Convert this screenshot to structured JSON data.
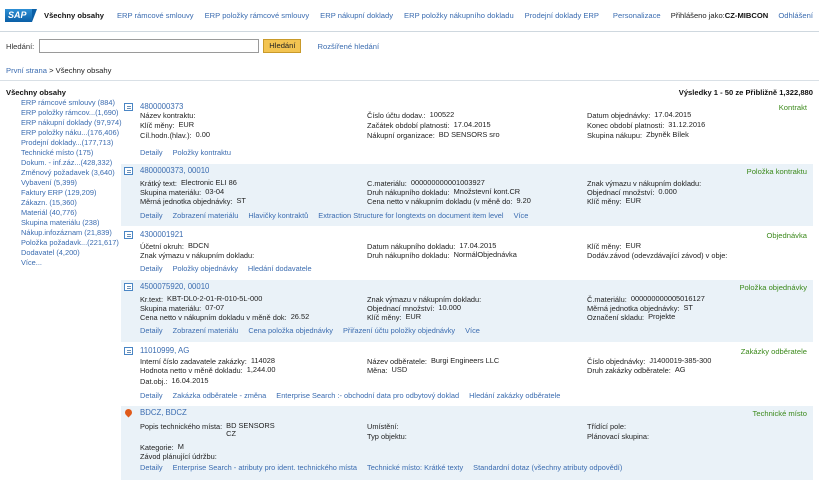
{
  "topbar": {
    "logo": "SAP",
    "nav": [
      "Všechny obsahy",
      "ERP rámcové smlouvy",
      "ERP položky rámcové smlouvy",
      "ERP nákupní doklady",
      "ERP položky nákupního dokladu",
      "Prodejní doklady ERP"
    ],
    "personalize": "Personalizace",
    "logged_label": "Přihlášeno jako:",
    "user": "CZ-MIBCON",
    "logout": "Odhlášení"
  },
  "search": {
    "label": "Hledání:",
    "value": "",
    "button": "Hledání",
    "advanced": "Rozšířené hledání"
  },
  "breadcrumb": {
    "home": "První strana",
    "separator": ">",
    "current": "Všechny obsahy"
  },
  "facets": {
    "title": "Všechny obsahy",
    "items": [
      "ERP rámcové smlouvy (884)",
      "ERP položky rámcov...(1,690)",
      "ERP nákupní doklady (97,974)",
      "ERP položky náku...(176,406)",
      "Prodejní doklady...(177,713)",
      "Technické místo (175)",
      "Dokum. - inf.záz...(428,332)",
      "Změnový požadavek (3,640)",
      "Vybavení (5,399)",
      "Faktury ERP (129,209)",
      "Zákazn. (15,360)",
      "Materiál (40,776)",
      "Skupina materiálu (238)",
      "Nákup.infozáznam (21,839)",
      "Položka požadavk...(221,617)",
      "Dodavatel (4,200)",
      "Více..."
    ]
  },
  "results_text": "Výsledky 1 - 50 ze Přibližně 1,322,880",
  "results": [
    {
      "title": "4800000373",
      "type": "Kontrakt",
      "fields": [
        [
          "Název kontraktu:",
          ""
        ],
        [
          "Číslo účtu dodav.:",
          "100522"
        ],
        [
          "Datum objednávky:",
          "17.04.2015"
        ],
        [
          "Klíč měny:",
          "EUR"
        ],
        [
          "Začátek období platnosti:",
          "17.04.2015"
        ],
        [
          "Konec období platnosti:",
          "31.12.2016"
        ],
        [
          "Cíl.hodn.(hlav.):",
          "0.00"
        ],
        [
          "Nákupní organizace:",
          "BD SENSORS sro"
        ],
        [
          "Skupina nákupu:",
          "Zbyněk Bílek"
        ]
      ],
      "links": [
        "Detaily",
        "Položky kontraktu"
      ]
    },
    {
      "title": "4800000373, 00010",
      "type": "Položka kontraktu",
      "fields": [
        [
          "Krátký text:",
          "Electronic ELI 86"
        ],
        [
          "C.materiálu:",
          "000000000001003927"
        ],
        [
          "Znak výmazu v nákupním dokladu:",
          ""
        ],
        [
          "Skupina materiálu:",
          "03-04"
        ],
        [
          "Druh nákupního dokladu:",
          "Množstevní kont.CR"
        ],
        [
          "Objednací množství:",
          "0.000"
        ],
        [
          "Měrná jednotka objednávky:",
          "ST"
        ],
        [
          "Cena netto v nákupním dokladu (v měně do:",
          "9.20"
        ],
        [
          "Klíč měny:",
          "EUR"
        ]
      ],
      "links": [
        "Detaily",
        "Zobrazení materiálu",
        "Hlavičky kontraktů",
        "Extraction Structure for longtexts on document item level",
        "Více"
      ]
    },
    {
      "title": "4300001921",
      "type": "Objednávka",
      "fields": [
        [
          "Účetní okruh:",
          "BDCN"
        ],
        [
          "Datum nákupního dokladu:",
          "17.04.2015"
        ],
        [
          "Klíč měny:",
          "EUR"
        ],
        [
          "Znak výmazu v nákupním dokladu:",
          ""
        ],
        [
          "Druh nákupního dokladu:",
          "NormálObjednávka"
        ],
        [
          "Dodáv.závod (odevzdávající závod) v obje:",
          ""
        ]
      ],
      "links": [
        "Detaily",
        "Položky objednávky",
        "Hledání dodavatele"
      ]
    },
    {
      "title": "4500075920, 00010",
      "type": "Položka objednávky",
      "fields": [
        [
          "Kr.text:",
          "KBT-DL0-2-01-R-010-5L-000"
        ],
        [
          "Znak výmazu v nákupním dokladu:",
          ""
        ],
        [
          "Č.materiálu:",
          "000000000005016127"
        ],
        [
          "Skupina materiálu:",
          "07-07"
        ],
        [
          "Objednací množství:",
          "10.000"
        ],
        [
          "Měrná jednotka objednávky:",
          "ST"
        ],
        [
          "Cena netto v nákupním dokladu v měně dok:",
          "26.52"
        ],
        [
          "Klíč měny:",
          "EUR"
        ],
        [
          "Označení skladu:",
          "Projekte"
        ]
      ],
      "links": [
        "Detaily",
        "Zobrazení materiálu",
        "Cena položka objednávky",
        "Přiřazení účtu položky objednávky",
        "Více"
      ]
    },
    {
      "title": "11010999, AG",
      "type": "Zakázky odběratele",
      "fields": [
        [
          "Interní číslo zadavatele zakázky:",
          "114028"
        ],
        [
          "Název odběratele:",
          "Burgi Engineers LLC"
        ],
        [
          "Číslo objednávky:",
          "J1400019-385-300"
        ],
        [
          "Hodnota netto v měně dokladu:",
          "1,244.00"
        ],
        [
          "Měna:",
          "USD"
        ],
        [
          "Druh zakázky odběratele:",
          "AG"
        ],
        [
          "Dat.obj.:",
          "16.04.2015"
        ]
      ],
      "links": [
        "Detaily",
        "Zakázka odběratele - změna",
        "Enterprise Search :- obchodní data pro odbytový doklad",
        "Hledání zakázky odběratele"
      ]
    },
    {
      "title": "BDCZ, BDCZ",
      "type": "Technické místo",
      "fields": [
        [
          "Popis technického místa:",
          "BD SENSORS\nCZ"
        ],
        [
          "Umístění:",
          ""
        ],
        [
          "Třídící pole:",
          ""
        ],
        [
          "Kategorie:",
          "M"
        ],
        [
          "Typ objektu:",
          ""
        ],
        [
          "Plánovací skupina:",
          ""
        ],
        [
          "Závod plánující údržbu:",
          ""
        ]
      ],
      "links": [
        "Detaily",
        "Enterprise Search - atributy pro ident. technického místa",
        "Technické místo: Krátké texty",
        "Standardní dotaz (všechny atributy odpovědí)"
      ]
    }
  ]
}
